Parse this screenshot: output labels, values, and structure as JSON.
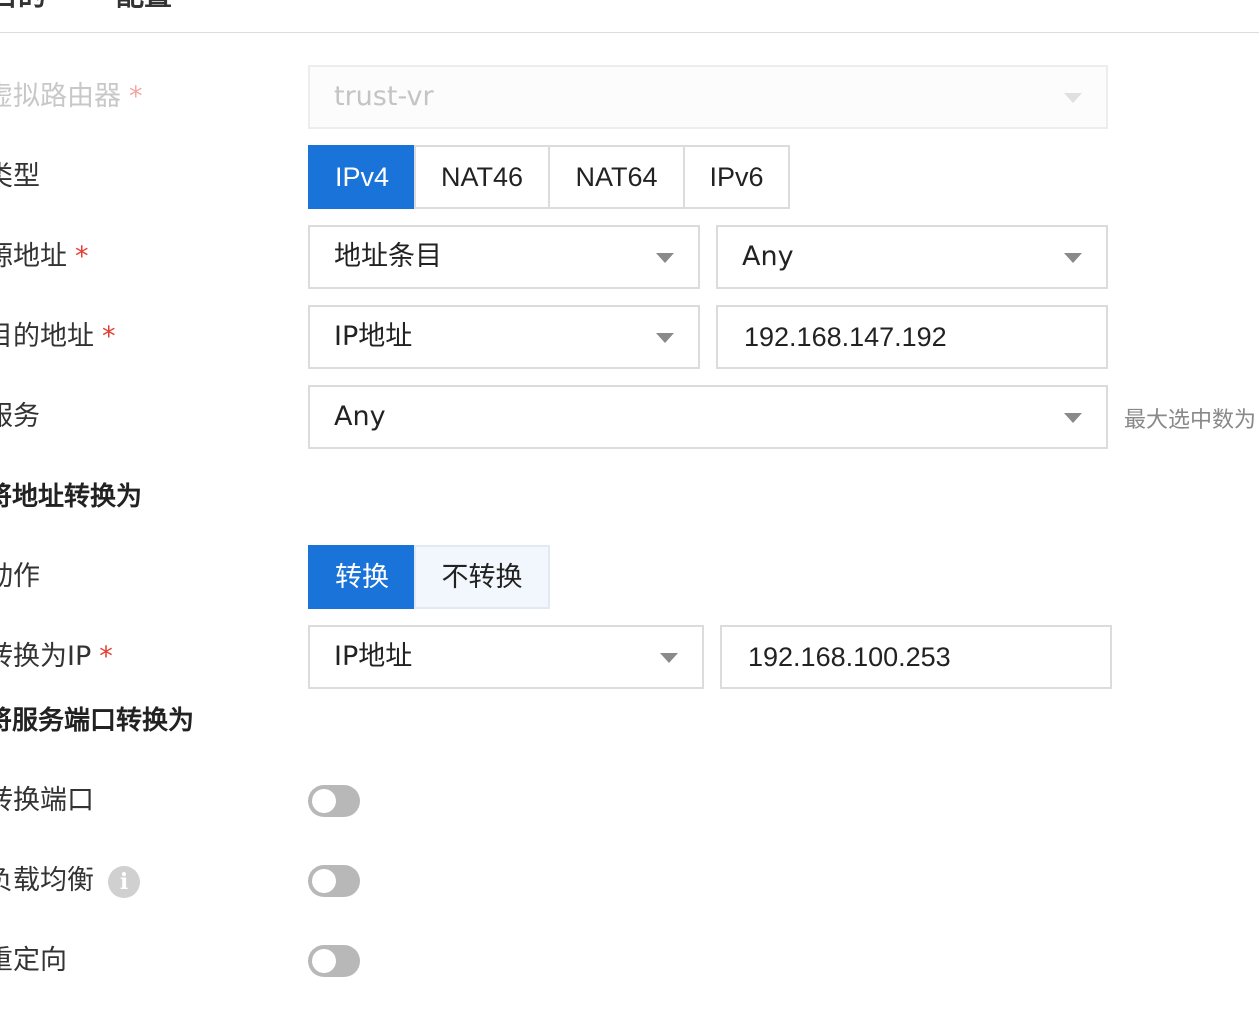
{
  "tabs": [
    {
      "label": "目的"
    },
    {
      "label": "配置"
    }
  ],
  "form": {
    "virtual_router": {
      "label": "虚拟路由器",
      "required": "*",
      "value": "trust-vr"
    },
    "type": {
      "label": "类型",
      "options": [
        "IPv4",
        "NAT46",
        "NAT64",
        "IPv6"
      ],
      "selected": "IPv4"
    },
    "source": {
      "label": "源地址",
      "required": "*",
      "type_value": "地址条目",
      "value": "Any"
    },
    "destination": {
      "label": "目的地址",
      "required": "*",
      "type_value": "IP地址",
      "value": "192.168.147.192"
    },
    "service": {
      "label": "服务",
      "value": "Any",
      "hint": "最大选中数为"
    },
    "section_address": "将地址转换为",
    "action": {
      "label": "动作",
      "options": [
        "转换",
        "不转换"
      ],
      "selected": "转换"
    },
    "translate_ip": {
      "label": "转换为IP",
      "required": "*",
      "type_value": "IP地址",
      "value": "192.168.100.253"
    },
    "section_port": "将服务端口转换为",
    "translate_port": {
      "label": "转换端口",
      "enabled": false
    },
    "load_balance": {
      "label": "负载均衡",
      "info_icon": "info-icon",
      "enabled": false
    },
    "redirect": {
      "label": "重定向",
      "enabled": false
    }
  },
  "colors": {
    "accent": "#1a73d9",
    "required": "#e43d33",
    "toggle_off": "#b8b8b8"
  }
}
